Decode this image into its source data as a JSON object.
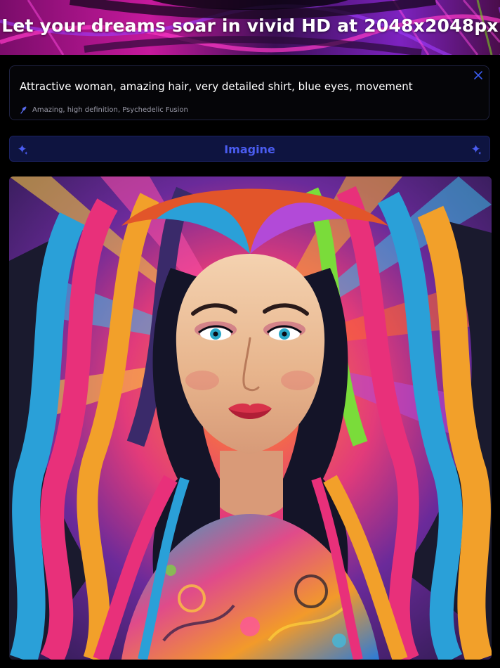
{
  "header": {
    "title": "Let your dreams soar in vivid HD at 2048x2048px"
  },
  "prompt": {
    "text": "Attractive woman, amazing hair, very detailed shirt, blue eyes, movement",
    "style_tags": "Amazing, high definition, Psychedelic Fusion",
    "close_icon": "close-icon",
    "style_icon": "pin-icon"
  },
  "imagine_button": {
    "label": "Imagine",
    "icon": "sparkle-icon"
  },
  "colors": {
    "background": "#000000",
    "accent": "#4a5cf0",
    "button_bg": "#0e1440",
    "card_border": "#1f2240"
  }
}
